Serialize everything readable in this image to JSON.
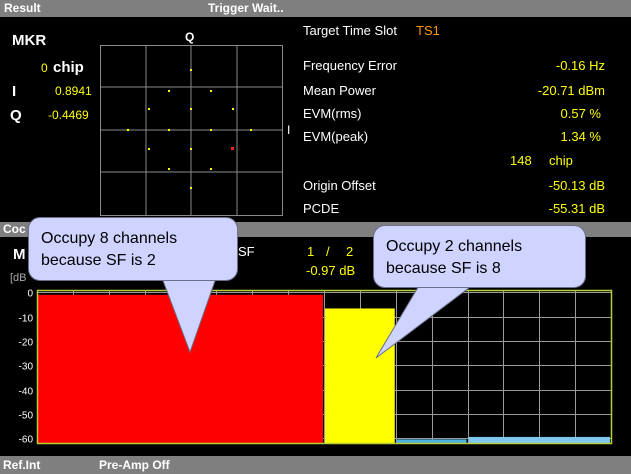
{
  "result_bar": {
    "title": "Result",
    "status": "Trigger Wait.."
  },
  "marker": {
    "mkr_label": "MKR",
    "position_value": "0",
    "position_unit": "chip",
    "i_label": "I",
    "i_value": "0.8941",
    "q_label": "Q",
    "q_value": "-0.4469"
  },
  "constellation": {
    "q_axis_label": "Q",
    "i_axis_label": "I"
  },
  "results": {
    "target_time_slot_label": "Target Time Slot",
    "target_time_slot_value": "TS1",
    "frequency_error_label": "Frequency Error",
    "frequency_error_value": "-0.16 Hz",
    "mean_power_label": "Mean Power",
    "mean_power_value": "-20.71 dBm",
    "evm_rms_label": "EVM(rms)",
    "evm_rms_value": "0.57 %",
    "evm_peak_label": "EVM(peak)",
    "evm_peak_value": "1.34 %",
    "evm_peak_chip_value": "148",
    "evm_peak_chip_unit": "chip",
    "origin_offset_label": "Origin Offset",
    "origin_offset_value": "-50.13 dB",
    "pcde_label": "PCDE",
    "pcde_value": "-55.31 dB"
  },
  "code_domain": {
    "bar_title_partial": "Coc",
    "marker_partial": "M",
    "unit_partial": "[dB",
    "sf_label": "SF",
    "sf_value_1": "1",
    "sf_slash": "/",
    "sf_value_2": "2",
    "level_value": "-0.97 dB"
  },
  "chart_data": {
    "type": "bar",
    "ylim": [
      -62,
      1
    ],
    "yticks": [
      "0",
      "-10",
      "-20",
      "-30",
      "-40",
      "-50",
      "-60"
    ],
    "ytick_values": [
      0,
      -10,
      -20,
      -30,
      -40,
      -50,
      -60
    ],
    "x_channels": 16,
    "series": [
      {
        "channel_start": 0,
        "channel_span": 8,
        "value": -0.97,
        "color": "#ff0000"
      },
      {
        "channel_start": 8,
        "channel_span": 2,
        "value": -6.6,
        "color": "#ffff00"
      },
      {
        "channel_start": 10,
        "channel_span": 2,
        "value": -60.5,
        "color": "#4fb3e0"
      },
      {
        "channel_start": 12,
        "channel_span": 4,
        "value": -59.5,
        "color": "#7ec8f0"
      }
    ]
  },
  "callouts": {
    "left_text": "Occupy 8 channels because SF is 2",
    "right_text": "Occupy 2 channels because SF is 8"
  },
  "status_bar": {
    "ref": "Ref.Int",
    "preamp": "Pre-Amp Off"
  },
  "colors": {
    "bar_gray": "#7f7f7f",
    "value_yellow": "#ffff00",
    "slot_orange": "#ff9900",
    "grid_green": "#b9cf3a"
  }
}
